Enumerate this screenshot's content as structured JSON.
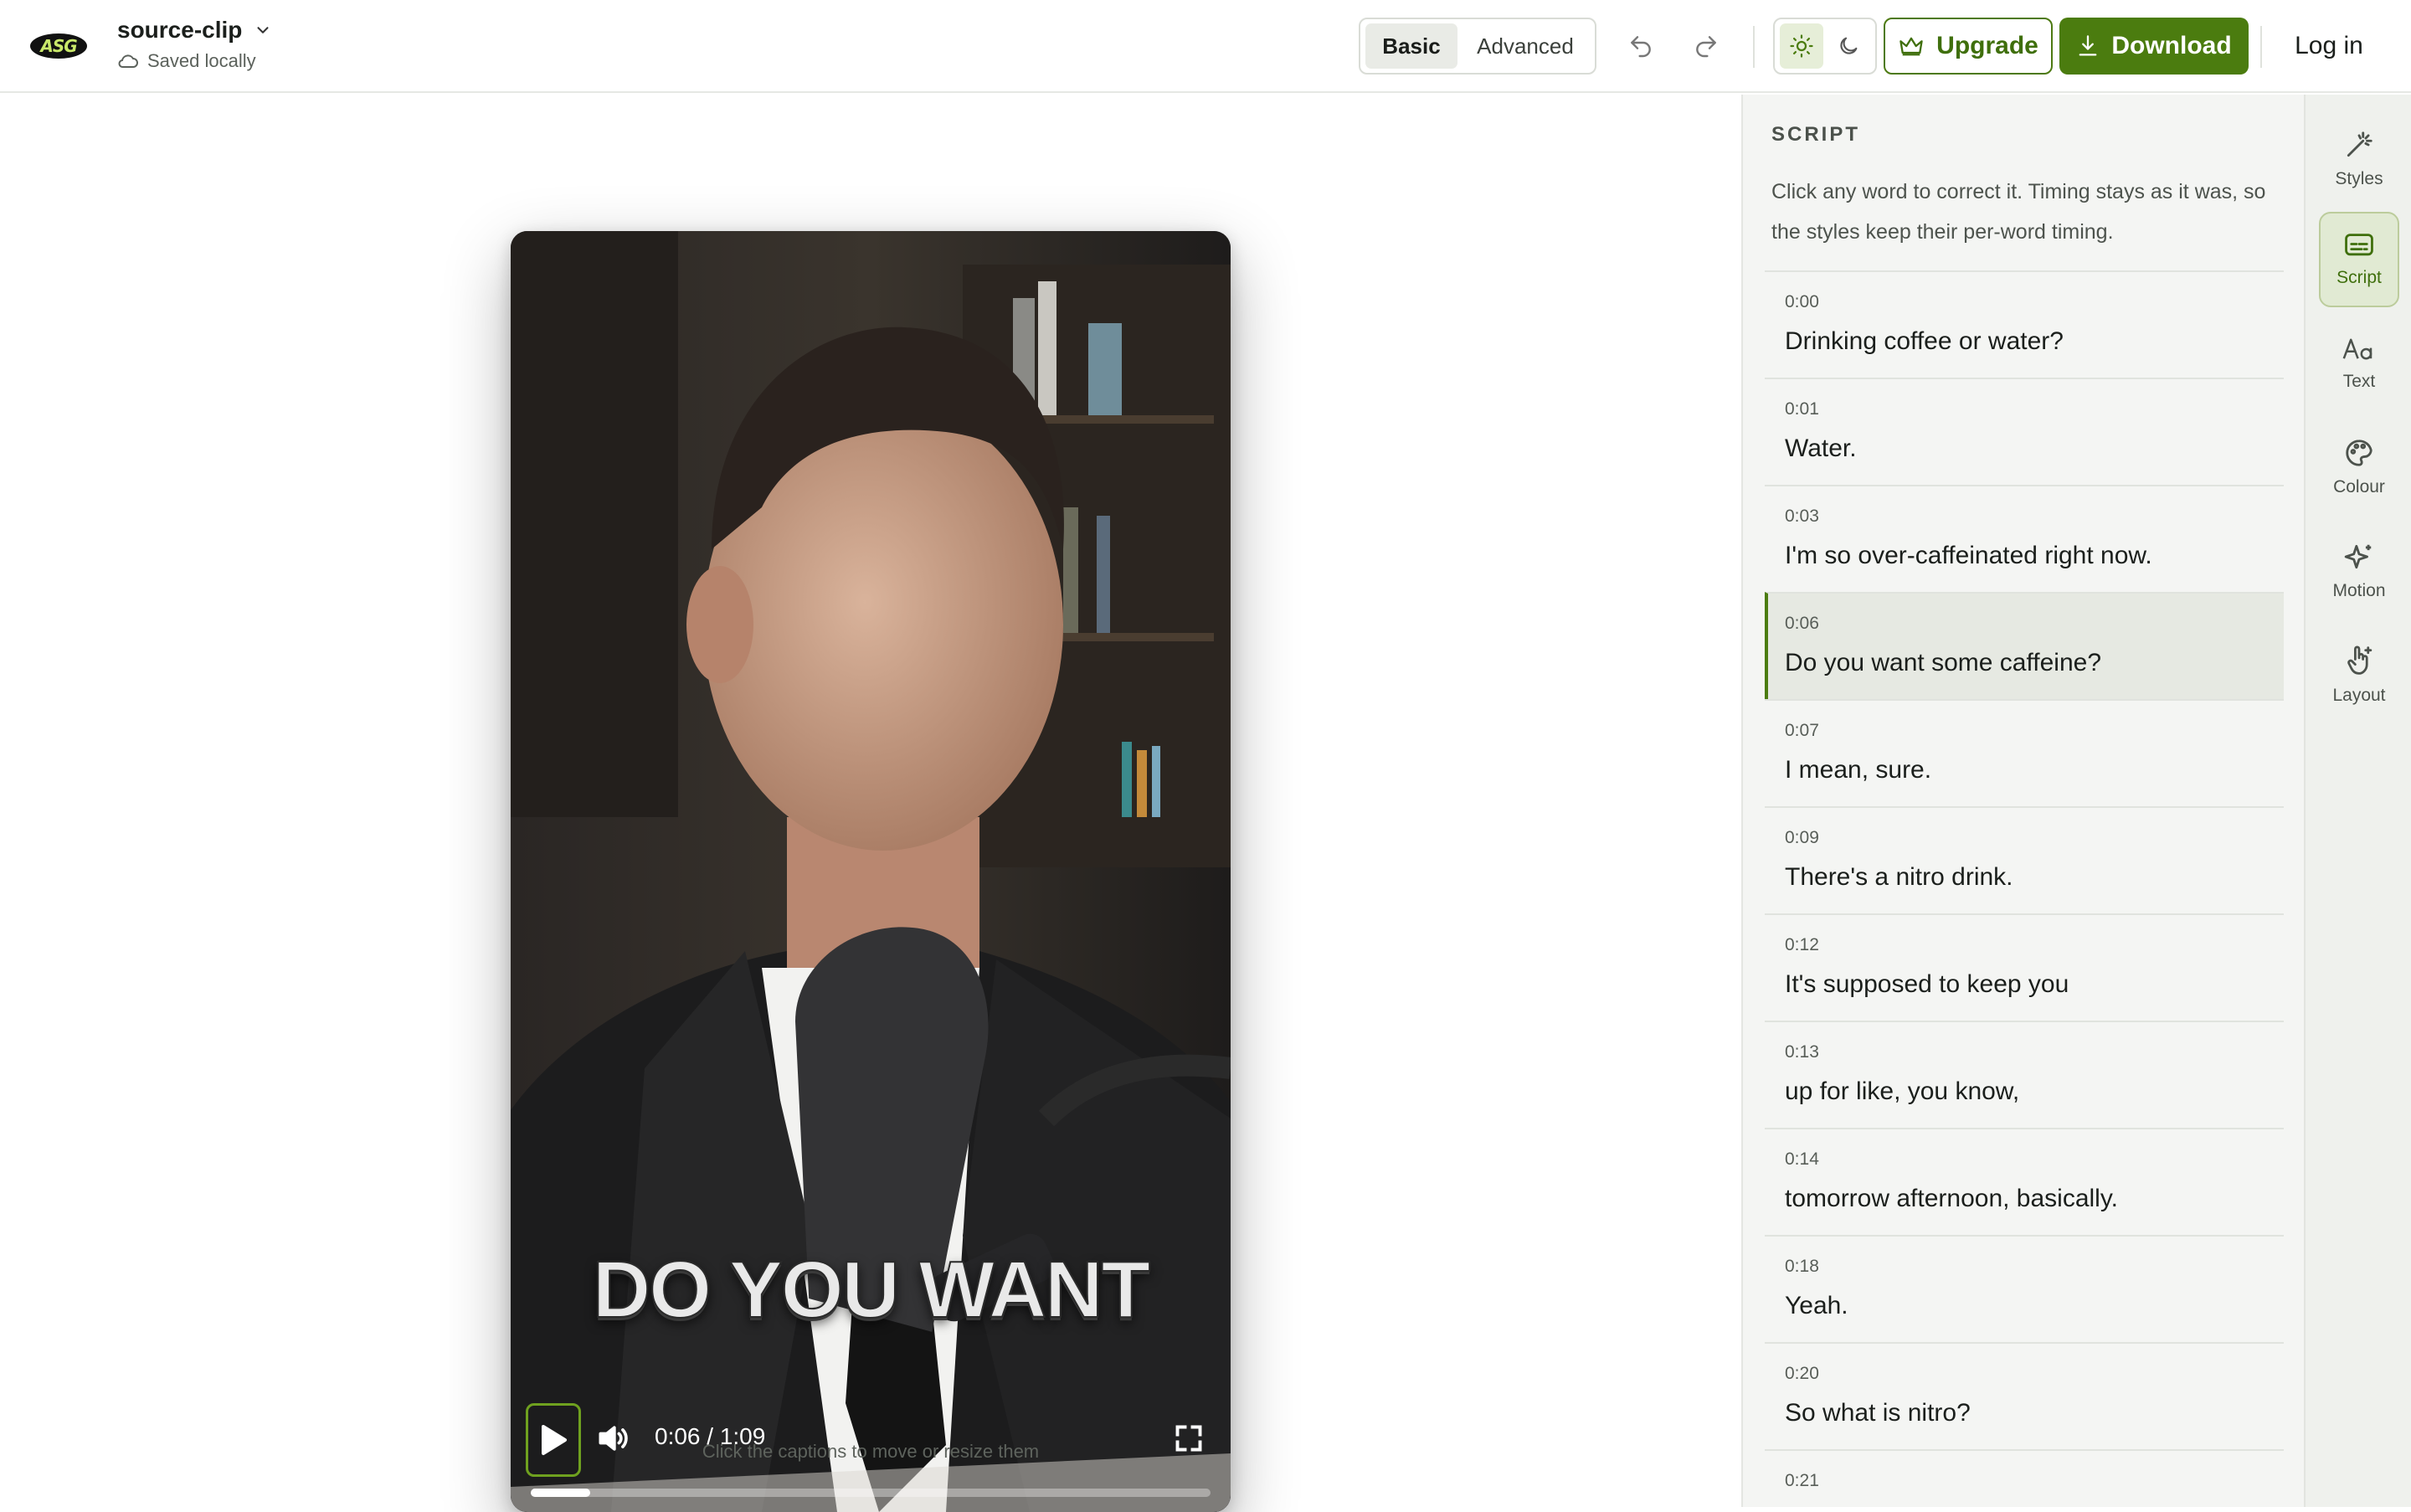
{
  "app": {
    "logo_text": "ASG",
    "project_name": "source-clip",
    "save_status": "Saved locally"
  },
  "toolbar": {
    "mode_basic": "Basic",
    "mode_advanced": "Advanced",
    "upgrade_label": "Upgrade",
    "download_label": "Download",
    "login_label": "Log in",
    "accent_color": "#4b7c0f"
  },
  "player": {
    "caption_text": "DO YOU WANT",
    "time_display": "0:06 / 1:09",
    "progress_fraction": 0.0869,
    "hint": "Click the captions to move or resize them"
  },
  "script": {
    "heading": "SCRIPT",
    "description": "Click any word to correct it. Timing stays as it was, so the styles keep their per-word timing.",
    "active_index": 3,
    "items": [
      {
        "time": "0:00",
        "text": "Drinking coffee or water?"
      },
      {
        "time": "0:01",
        "text": "Water."
      },
      {
        "time": "0:03",
        "text": "I'm so over-caffeinated right now."
      },
      {
        "time": "0:06",
        "text": "Do you want some caffeine?"
      },
      {
        "time": "0:07",
        "text": "I mean, sure."
      },
      {
        "time": "0:09",
        "text": "There's a nitro drink."
      },
      {
        "time": "0:12",
        "text": "It's supposed to keep you"
      },
      {
        "time": "0:13",
        "text": "up for like, you know,"
      },
      {
        "time": "0:14",
        "text": "tomorrow afternoon, basically."
      },
      {
        "time": "0:18",
        "text": "Yeah."
      },
      {
        "time": "0:20",
        "text": "So what is nitro?"
      },
      {
        "time": "0:21",
        "text": ""
      }
    ]
  },
  "rail": {
    "items": [
      {
        "label": "Styles",
        "icon": "magic-wand-icon"
      },
      {
        "label": "Script",
        "icon": "subtitles-icon"
      },
      {
        "label": "Text",
        "icon": "text-aa-icon"
      },
      {
        "label": "Colour",
        "icon": "palette-icon"
      },
      {
        "label": "Motion",
        "icon": "sparkle-icon"
      },
      {
        "label": "Layout",
        "icon": "hand-pointer-icon"
      }
    ]
  }
}
